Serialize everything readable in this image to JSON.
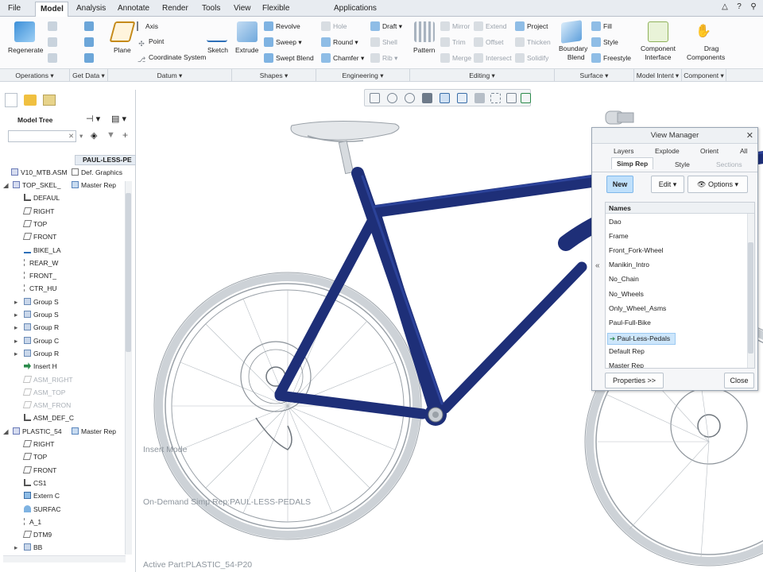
{
  "menu": {
    "tabs": [
      "File",
      "Model",
      "Analysis",
      "Annotate",
      "Render",
      "Tools",
      "View",
      "Flexible Modeling",
      "Applications"
    ],
    "active": "Model"
  },
  "ribbon": {
    "regenerate": "Regenerate",
    "plane": "Plane",
    "axis": "Axis",
    "point": "Point",
    "coordinate_system": "Coordinate System",
    "sketch": "Sketch",
    "extrude": "Extrude",
    "revolve": "Revolve",
    "sweep": "Sweep",
    "swept_blend": "Swept Blend",
    "hole": "Hole",
    "round": "Round",
    "chamfer": "Chamfer",
    "draft": "Draft",
    "shell": "Shell",
    "rib": "Rib",
    "pattern": "Pattern",
    "mirror": "Mirror",
    "trim": "Trim",
    "merge": "Merge",
    "extend": "Extend",
    "offset": "Offset",
    "intersect": "Intersect",
    "project": "Project",
    "thicken": "Thicken",
    "solidify": "Solidify",
    "boundary_blend_1": "Boundary",
    "boundary_blend_2": "Blend",
    "fill": "Fill",
    "style": "Style",
    "freestyle": "Freestyle",
    "component_interface_1": "Component",
    "component_interface_2": "Interface",
    "drag_components_1": "Drag",
    "drag_components_2": "Components"
  },
  "groups": [
    "Operations ▾",
    "Get Data ▾",
    "Datum ▾",
    "Shapes ▾",
    "Engineering ▾",
    "Editing ▾",
    "Surface ▾",
    "Model Intent ▾",
    "Component ▾"
  ],
  "left_panel": {
    "model_tree_label": "Model Tree",
    "search_placeholder": "",
    "header_name": "PAUL-LESS-PE",
    "root": "V10_MTB.ASM",
    "root_rep": "Def. Graphics",
    "items": [
      {
        "label": "TOP_SKEL_",
        "rep": "Master Rep",
        "type": "part",
        "gray": false
      },
      {
        "label": "DEFAUL",
        "type": "csys",
        "gray": false
      },
      {
        "label": "RIGHT",
        "type": "plane",
        "gray": false
      },
      {
        "label": "TOP",
        "type": "plane",
        "gray": false
      },
      {
        "label": "FRONT",
        "type": "plane",
        "gray": false
      },
      {
        "label": "BIKE_LA",
        "type": "sketch",
        "gray": false
      },
      {
        "label": "REAR_W",
        "type": "axis",
        "gray": false
      },
      {
        "label": "FRONT_",
        "type": "axis",
        "gray": false
      },
      {
        "label": "CTR_HU",
        "type": "axis",
        "gray": false
      },
      {
        "label": "Group S",
        "type": "group",
        "gray": false
      },
      {
        "label": "Group S",
        "type": "group",
        "gray": false
      },
      {
        "label": "Group R",
        "type": "group",
        "gray": false
      },
      {
        "label": "Group C",
        "type": "group",
        "gray": false
      },
      {
        "label": "Group R",
        "type": "group",
        "gray": false
      },
      {
        "label": "Insert H",
        "type": "insert",
        "gray": false
      },
      {
        "label": "ASM_RIGHT",
        "type": "plane",
        "gray": true
      },
      {
        "label": "ASM_TOP",
        "type": "plane",
        "gray": true
      },
      {
        "label": "ASM_FRON",
        "type": "plane",
        "gray": true
      },
      {
        "label": "ASM_DEF_C",
        "type": "csys",
        "gray": false
      },
      {
        "label": "PLASTIC_54",
        "rep": "Master Rep",
        "type": "part",
        "gray": false
      },
      {
        "label": "RIGHT",
        "type": "plane",
        "gray": false
      },
      {
        "label": "TOP",
        "type": "plane",
        "gray": false
      },
      {
        "label": "FRONT",
        "type": "plane",
        "gray": false
      },
      {
        "label": "CS1",
        "type": "csys",
        "gray": false
      },
      {
        "label": "Extern C",
        "type": "copy",
        "gray": false
      },
      {
        "label": "SURFAC",
        "type": "surface",
        "gray": false
      },
      {
        "label": "A_1",
        "type": "axis",
        "gray": false
      },
      {
        "label": "DTM9",
        "type": "plane",
        "gray": false
      },
      {
        "label": "BB",
        "type": "group",
        "gray": false
      }
    ]
  },
  "canvas": {
    "insert_mode": "Insert Mode",
    "on_demand": "On-Demand Simp Rep:PAUL-LESS-PEDALS",
    "active_part": "Active Part:PLASTIC_54-P20"
  },
  "view_manager": {
    "title": "View Manager",
    "tabs_row1": [
      "Layers",
      "Explode",
      "Orient",
      "All"
    ],
    "tabs_row2": [
      "Simp Rep",
      "Style",
      "Sections"
    ],
    "active_tab": "Simp Rep",
    "new_label": "New",
    "edit_label": "Edit",
    "options_label": "Options",
    "names_header": "Names",
    "items": [
      "Dao",
      "Frame",
      "Front_Fork-Wheel",
      "Manikin_Intro",
      "No_Chain",
      "No_Wheels",
      "Only_Wheel_Asms",
      "Paul-Full-Bike",
      "Paul-Less-Pedals",
      "Default Rep",
      "Master Rep"
    ],
    "selected": "Paul-Less-Pedals",
    "properties_label": "Properties >>",
    "close_label": "Close"
  },
  "colors": {
    "frame": "#1e2f78",
    "accent": "#2a7fd4",
    "selection": "#cde6fb"
  }
}
